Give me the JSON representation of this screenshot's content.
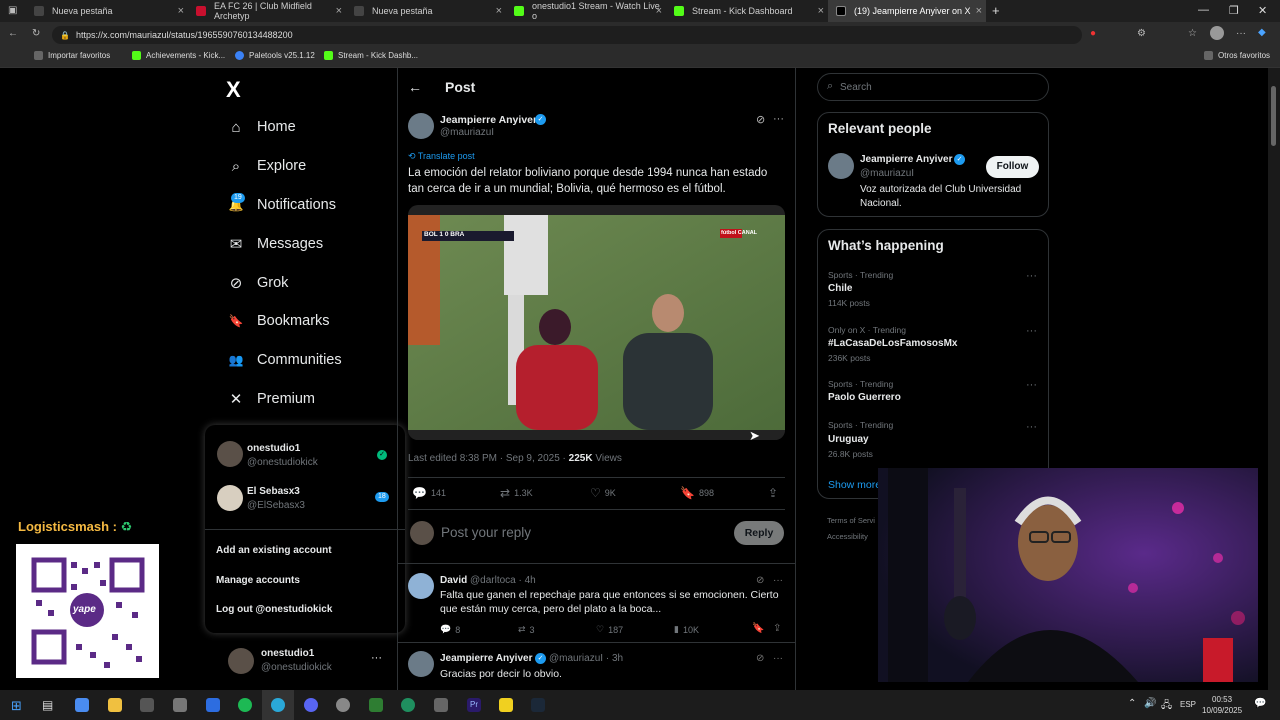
{
  "browser": {
    "tabs": [
      {
        "label": "Nueva pestaña",
        "color": "#444444"
      },
      {
        "label": "EA FC 26 | Club Midfield Archetyp",
        "color": "#c8102e"
      },
      {
        "label": "Nueva pestaña",
        "color": "#444444"
      },
      {
        "label": "onestudio1 Stream - Watch Live o",
        "color": "#53fc18"
      },
      {
        "label": "Stream - Kick Dashboard",
        "color": "#53fc18"
      },
      {
        "label": "(19) Jeampierre Anyiver on X",
        "color": "#000000"
      }
    ],
    "new_tab": "+",
    "url": "https://x.com/mauriazul/status/1965590760134488200",
    "bookmarks": [
      "Importar favoritos",
      "Achievements - Kick...",
      "Paletools v25.1.12",
      "Stream - Kick Dashb..."
    ],
    "other_bookmarks": "Otros favoritos"
  },
  "nav": {
    "logo": "X",
    "items": [
      {
        "label": "Home",
        "icon": "home-icon",
        "glyph": "⌂"
      },
      {
        "label": "Explore",
        "icon": "search-icon",
        "glyph": "⌕"
      },
      {
        "label": "Notifications",
        "icon": "bell-icon",
        "glyph": "🔔"
      },
      {
        "label": "Messages",
        "icon": "envelope-icon",
        "glyph": "✉"
      },
      {
        "label": "Grok",
        "icon": "grok-icon",
        "glyph": "⊘"
      },
      {
        "label": "Bookmarks",
        "icon": "bookmark-icon",
        "glyph": "🔖"
      },
      {
        "label": "Communities",
        "icon": "people-icon",
        "glyph": "👥"
      },
      {
        "label": "Premium",
        "icon": "x-icon",
        "glyph": "✕"
      }
    ],
    "notif_badge": "19"
  },
  "account_menu": {
    "accounts": [
      {
        "name": "onestudio1",
        "handle": "@onestudiokick"
      },
      {
        "name": "El Sebasx3",
        "handle": "@ElSebasx3",
        "badge": "18"
      }
    ],
    "add": "Add an existing account",
    "manage": "Manage accounts",
    "logout": "Log out @onestudiokick",
    "current_name": "onestudio1",
    "current_handle": "@onestudiokick"
  },
  "overlay": {
    "logistics": "Logisticsmash :",
    "qr_brand": "yape"
  },
  "post": {
    "header": "Post",
    "author": "Jeampierre Anyiver",
    "handle": "@mauriazuI",
    "translate": "Translate post",
    "text": "La emoción del relator boliviano porque desde 1994 nunca han estado tan cerca de ir a un mundial; Bolivia, qué hermoso es el fútbol.",
    "video_score": "BOL 1 0 BRA",
    "video_channel": "fútbol CANAL",
    "edited": "Last edited 8:38 PM · Sep 9, 2025 ·",
    "views_count": "225K",
    "views_label": "Views",
    "replies": "141",
    "reposts": "1.3K",
    "likes": "9K",
    "bookmarks": "898",
    "reply_placeholder": "Post your reply",
    "reply_button": "Reply"
  },
  "replies": [
    {
      "name": "David",
      "handle": "@darltoca · 4h",
      "text": "Falta que ganen el repechaje para que entonces si se emocionen. Cierto que están muy cerca, pero del plato a la boca...",
      "replies": "8",
      "reposts": "3",
      "likes": "187",
      "views": "10K"
    },
    {
      "name": "Jeampierre Anyiver",
      "handle": "@mauriazuI · 3h",
      "text": "Gracias por decir lo obvio."
    }
  ],
  "sidebar": {
    "search_placeholder": "Search",
    "relevant_title": "Relevant people",
    "person_name": "Jeampierre Anyiver",
    "person_handle": "@mauriazuI",
    "person_bio": "Voz autorizada del Club Universidad Nacional.",
    "follow": "Follow",
    "happening_title": "What’s happening",
    "trends": [
      {
        "cat": "Sports · Trending",
        "title": "Chile",
        "count": "114K posts"
      },
      {
        "cat": "Only on X · Trending",
        "title": "#LaCasaDeLosFamososMx",
        "count": "236K posts"
      },
      {
        "cat": "Sports · Trending",
        "title": "Paolo Guerrero",
        "count": ""
      },
      {
        "cat": "Sports · Trending",
        "title": "Uruguay",
        "count": "26.8K posts"
      }
    ],
    "show_more": "Show more",
    "footer1": "Terms of Servi",
    "footer2": "Accessibility"
  },
  "taskbar": {
    "lang": "ESP",
    "time": "00:53",
    "date": "10/09/2025"
  },
  "colors": {
    "accent": "#1d9bf0",
    "kick": "#53fc18",
    "bg": "#000000"
  }
}
